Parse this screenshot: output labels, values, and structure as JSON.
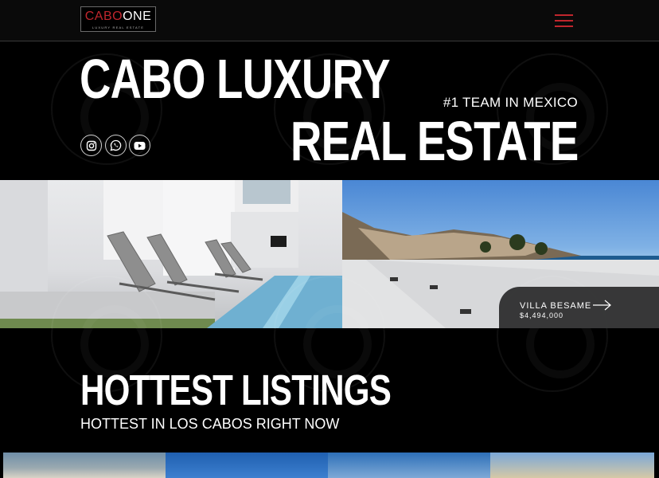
{
  "header": {
    "logo": {
      "cabo": "CABO",
      "one": "ONE",
      "sub": "LUXURY REAL ESTATE"
    },
    "menu_icon": "hamburger-menu-icon",
    "accent_color": "#c0262d"
  },
  "hero": {
    "title_line1": "CABO LUXURY",
    "title_line2": "REAL ESTATE",
    "tagline": "#1 TEAM IN MEXICO",
    "socials": [
      {
        "icon": "instagram-icon"
      },
      {
        "icon": "whatsapp-icon"
      },
      {
        "icon": "youtube-icon"
      }
    ]
  },
  "featured": {
    "name": "VILLA BESAME",
    "price": "$4,494,000",
    "arrow_icon": "arrow-right-icon"
  },
  "listings": {
    "title": "HOTTEST LISTINGS",
    "subtitle": "HOTTEST IN LOS CABOS RIGHT NOW"
  }
}
